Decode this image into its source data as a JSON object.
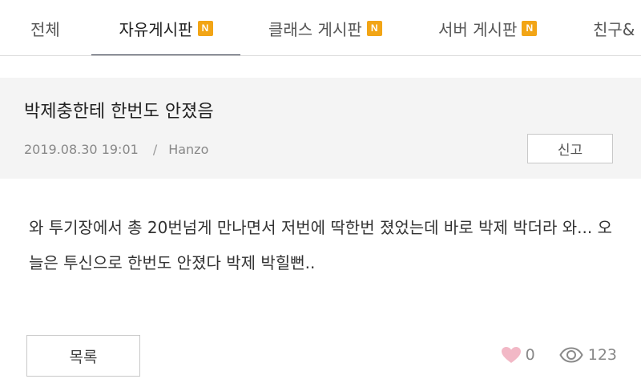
{
  "tabs": [
    {
      "label": "전체",
      "new_badge": ""
    },
    {
      "label": "자유게시판",
      "new_badge": "N"
    },
    {
      "label": "클래스 게시판",
      "new_badge": "N"
    },
    {
      "label": "서버 게시판",
      "new_badge": "N"
    },
    {
      "label": "친구&",
      "new_badge": ""
    }
  ],
  "active_tab": "자유게시판",
  "post": {
    "title": "박제충한테 한번도 안졌음",
    "date": "2019.08.30 19:01",
    "separator": "/",
    "author": "Hanzo",
    "report_label": "신고",
    "body": "와 투기장에서 총 20번넘게 만나면서 저번에 딱한번 졌었는데 바로 박제 박더라 와... 오늘은 투신으로 한번도 안졌다 박제 박힐뻔.."
  },
  "footer": {
    "list_label": "목록",
    "likes": "0",
    "views": "123"
  },
  "colors": {
    "badge": "#f2a516",
    "active_underline": "#2b3142",
    "heart": "#f2b8c6"
  },
  "icons": {
    "like": "heart-icon",
    "views": "eye-icon"
  }
}
